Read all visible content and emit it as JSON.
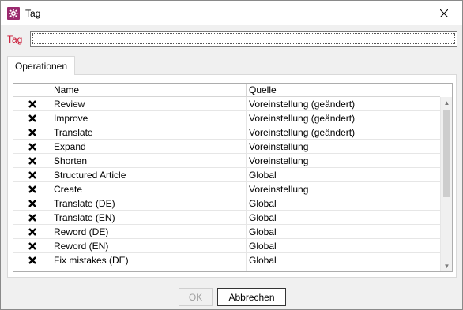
{
  "window": {
    "title": "Tag",
    "close_symbol": "✕"
  },
  "form": {
    "tag_label": "Tag",
    "tag_value": ""
  },
  "tabs": [
    {
      "label": "Operationen"
    }
  ],
  "table": {
    "columns": [
      "",
      "Name",
      "Quelle"
    ],
    "rows": [
      {
        "checked": "✕",
        "name": "Review",
        "quelle": "Voreinstellung (geändert)"
      },
      {
        "checked": "✕",
        "name": "Improve",
        "quelle": "Voreinstellung (geändert)"
      },
      {
        "checked": "✕",
        "name": "Translate",
        "quelle": "Voreinstellung (geändert)"
      },
      {
        "checked": "✕",
        "name": "Expand",
        "quelle": "Voreinstellung"
      },
      {
        "checked": "✕",
        "name": "Shorten",
        "quelle": "Voreinstellung"
      },
      {
        "checked": "✕",
        "name": "Structured Article",
        "quelle": "Global"
      },
      {
        "checked": "✕",
        "name": "Create",
        "quelle": "Voreinstellung"
      },
      {
        "checked": "✕",
        "name": "Translate (DE)",
        "quelle": "Global"
      },
      {
        "checked": "✕",
        "name": "Translate (EN)",
        "quelle": "Global"
      },
      {
        "checked": "✕",
        "name": "Reword (DE)",
        "quelle": "Global"
      },
      {
        "checked": "✕",
        "name": "Reword (EN)",
        "quelle": "Global"
      },
      {
        "checked": "✕",
        "name": "Fix mistakes (DE)",
        "quelle": "Global"
      },
      {
        "checked": "✕",
        "name": "Fix mistakes (EN)",
        "quelle": "Global"
      }
    ]
  },
  "buttons": {
    "ok": "OK",
    "cancel": "Abbrechen"
  },
  "colors": {
    "accent": "#9b2a6f",
    "tag_label": "#c8102e"
  }
}
